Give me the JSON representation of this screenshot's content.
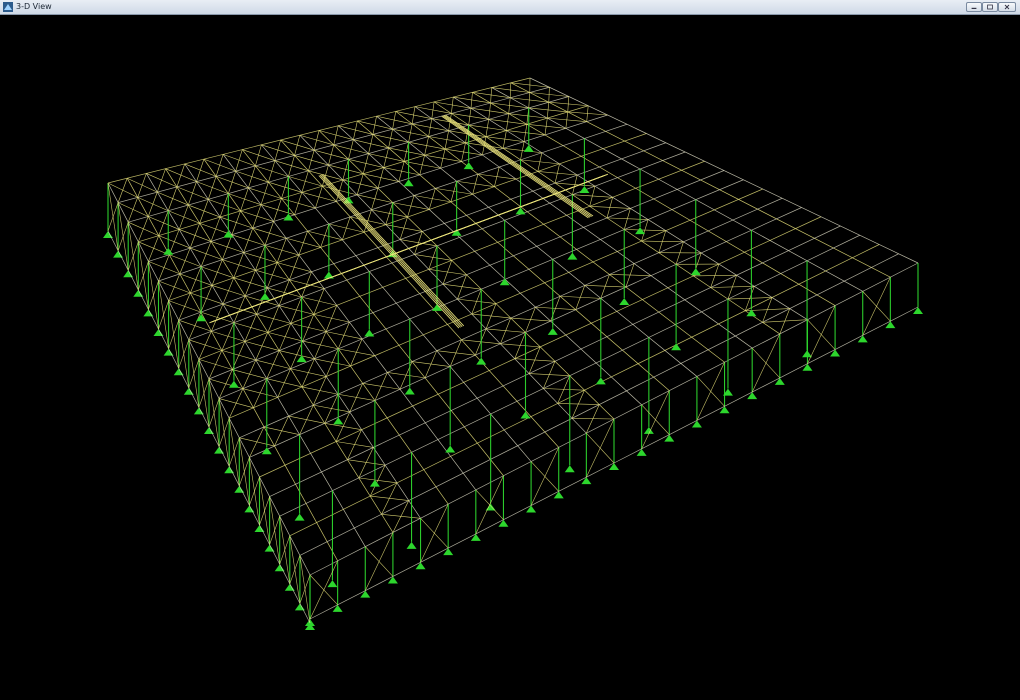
{
  "window": {
    "title": "3-D View"
  },
  "colors": {
    "frame_primary": "#e9e27a",
    "frame_secondary": "#d8d6c0",
    "support": "#2dd62d",
    "background": "#000000"
  },
  "icons": {
    "app": "structure-app-icon",
    "minimize": "minimize-icon",
    "maximize": "maximize-icon",
    "close": "close-icon"
  }
}
